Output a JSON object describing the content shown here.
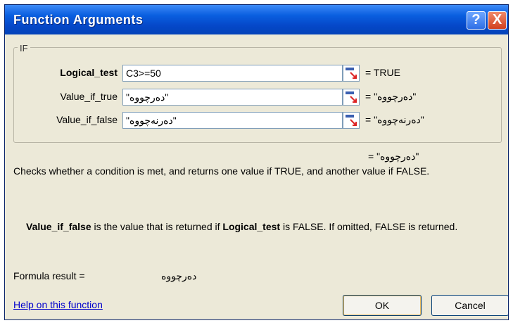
{
  "window": {
    "title": "Function Arguments",
    "help_button": "?",
    "close_button": "X"
  },
  "group": {
    "label": "IF"
  },
  "arguments": [
    {
      "label": "Logical_test",
      "value": "C3>=50",
      "result": "= TRUE"
    },
    {
      "label": "Value_if_true",
      "value": "\"دەرچووە\"",
      "result": "= \"دەرچووە\""
    },
    {
      "label": "Value_if_false",
      "value": "\"دەرنەچووە\"",
      "result": "= \"دەرنەچووە\""
    }
  ],
  "overall_result": "= \"دەرچووە\"",
  "description": "Checks whether a condition is met, and returns one value if TRUE, and another value if FALSE.",
  "argument_help": {
    "name": "Value_if_false",
    "text_part1": " is the value that is returned if ",
    "inline_name": "Logical_test",
    "text_part2": " is FALSE. If omitted, FALSE is returned."
  },
  "formula_result": {
    "label": "Formula result =",
    "value": "دەرچووە"
  },
  "help_link": "Help on this function",
  "buttons": {
    "ok": "OK",
    "cancel": "Cancel"
  },
  "colors": {
    "titlebar": "#0548c9",
    "dialog_bg": "#ece9d8",
    "link": "#0000cc"
  }
}
